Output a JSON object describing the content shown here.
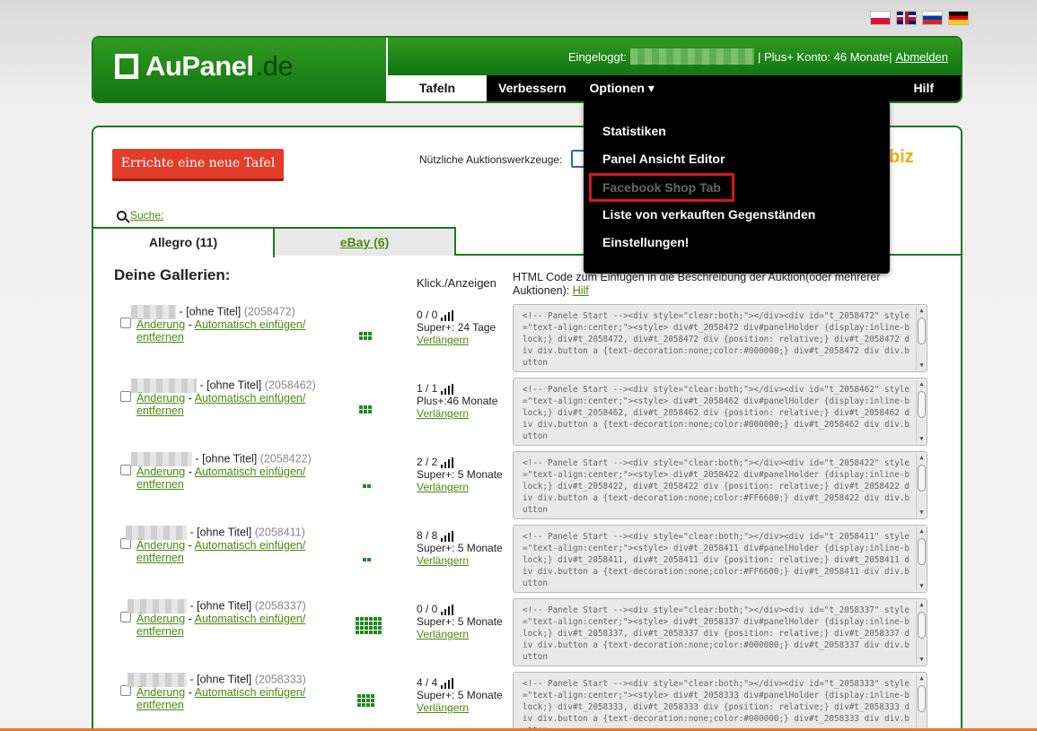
{
  "flags": [
    "flag-pl",
    "flag-gb",
    "flag-ru",
    "flag-de"
  ],
  "logo": {
    "name": "AuPanel",
    "tld": ".de"
  },
  "header": {
    "logged_in_label": "Eingeloggt:",
    "account_info": "| Plus+ Konto: 46 Monate|",
    "logout": "Abmelden"
  },
  "nav": {
    "tafeln": "Tafeln",
    "verbessern": "Verbessern",
    "optionen": "Optionen ▾",
    "hilf": "Hilf"
  },
  "dropdown": [
    {
      "label": "Statistiken",
      "state": "normal"
    },
    {
      "label": "Panel Ansicht Editor",
      "state": "normal"
    },
    {
      "label": "Facebook Shop Tab",
      "state": "disabled-highlighted"
    },
    {
      "label": "Liste von verkauften Gegenständen",
      "state": "normal"
    },
    {
      "label": "Einstellungen!",
      "state": "normal"
    }
  ],
  "toolbar": {
    "new_panel_button": "Errichte eine neue Tafel",
    "tools_label": "Nützliche Auktionswerkzeuge:",
    "tool_biz": "biz",
    "search": "Suche:"
  },
  "tabs": {
    "allegro": "Allegro (11)",
    "ebay": "eBay (6)"
  },
  "columns": {
    "galleries": "Deine Gallerien:",
    "clicks": "Klick./Anzeigen",
    "html_code": "HTML Code zum Einfügen in die Beschreibung der Auktion(oder mehrerer Auktionen):",
    "help": "Hilf"
  },
  "row_labels": {
    "untitled": "- [ohne Titel]",
    "change": "Änderung",
    "auto": "Automatisch einfügen/",
    "remove": "entfernen",
    "extend": "Verlängern"
  },
  "galleries": [
    {
      "id": "(2058472)",
      "stats": "0 / 0",
      "plan": "Super+: 24 Tage",
      "grid": "3x2",
      "code": "<!-- Panele Start --><div style=\"clear:both;\"></div><div id=\"t_2058472\" style=\"text-align:center;\"><style> div#t_2058472 div#panelHolder {display:inline-block;} div#t_2058472, div#t_2058472 div {position: relative;} div#t_2058472 div div.button a {text-decoration:none;color:#000000;} div#t_2058472 div div.button"
    },
    {
      "id": "(2058462)",
      "stats": "1 / 1",
      "plan": "Plus+:46 Monate",
      "grid": "3x2",
      "code": "<!-- Panele Start --><div style=\"clear:both;\"></div><div id=\"t_2058462\" style=\"text-align:center;\"><style> div#t_2058462 div#panelHolder {display:inline-block;} div#t_2058462, div#t_2058462 div {position: relative;} div#t_2058462 div div.button a {text-decoration:none;color:#000000;} div#t_2058462 div div.button"
    },
    {
      "id": "(2058422)",
      "stats": "2 / 2",
      "plan": "Super+: 5 Monate",
      "grid": "2x1",
      "code": "<!-- Panele Start --><div style=\"clear:both;\"></div><div id=\"t_2058422\" style=\"text-align:center;\"><style> div#t_2058422 div#panelHolder {display:inline-block;} div#t_2058422, div#t_2058422 div {position: relative;} div#t_2058422 div div.button a {text-decoration:none;color:#FF6600;} div#t_2058422 div div.button"
    },
    {
      "id": "(2058411)",
      "stats": "8 / 8",
      "plan": "Super+: 5 Monate",
      "grid": "2x1",
      "code": "<!-- Panele Start --><div style=\"clear:both;\"></div><div id=\"t_2058411\" style=\"text-align:center;\"><style> div#t_2058411 div#panelHolder {display:inline-block;} div#t_2058411, div#t_2058411 div {position: relative;} div#t_2058411 div div.button a {text-decoration:none;color:#FF6600;} div#t_2058411 div div.button"
    },
    {
      "id": "(2058337)",
      "stats": "0 / 0",
      "plan": "Super+: 5 Monate",
      "grid": "6x4",
      "code": "<!-- Panele Start --><div style=\"clear:both;\"></div><div id=\"t_2058337\" style=\"text-align:center;\"><style> div#t_2058337 div#panelHolder {display:inline-block;} div#t_2058337, div#t_2058337 div {position: relative;} div#t_2058337 div div.button a {text-decoration:none;color:#000000;} div#t_2058337 div div.button"
    },
    {
      "id": "(2058333)",
      "stats": "4 / 4",
      "plan": "Super+: 5 Monate",
      "grid": "4x3",
      "code": "<!-- Panele Start --><div style=\"clear:both;\"></div><div id=\"t_2058333\" style=\"text-align:center;\"><style> div#t_2058333 div#panelHolder {display:inline-block;} div#t_2058333, div#t_2058333 div {position: relative;} div#t_2058333 div div.button a {text-decoration:none;color:#000000;} div#t_2058333 div div.button"
    }
  ]
}
